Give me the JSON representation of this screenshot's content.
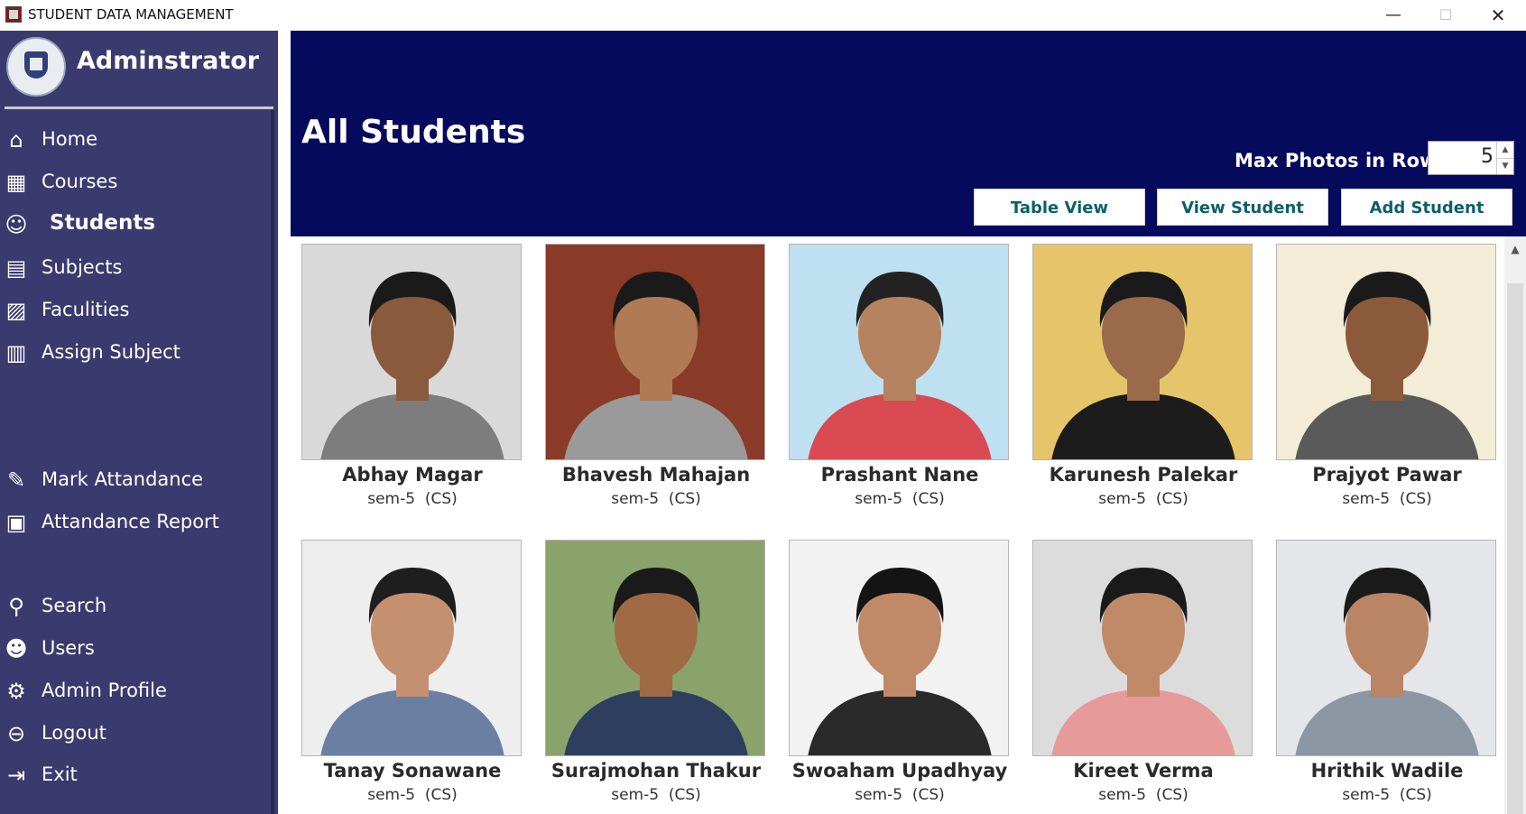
{
  "window": {
    "title": "STUDENT DATA MANAGEMENT",
    "min_glyph": "—",
    "max_glyph": "☐",
    "close_glyph": "✕"
  },
  "sidebar": {
    "title": "Adminstrator",
    "items": [
      {
        "label": "Home",
        "icon": "home-icon",
        "glyph": "⌂",
        "active": false
      },
      {
        "label": "Courses",
        "icon": "courses-icon",
        "glyph": "▦",
        "active": false
      },
      {
        "label": "Students",
        "icon": "student-icon",
        "glyph": "☺",
        "active": true
      },
      {
        "label": "Subjects",
        "icon": "subjects-icon",
        "glyph": "▤",
        "active": false
      },
      {
        "label": "Faculities",
        "icon": "faculties-icon",
        "glyph": "▨",
        "active": false
      },
      {
        "label": "Assign Subject",
        "icon": "assign-icon",
        "glyph": "▥",
        "active": false
      },
      {
        "label": "Mark Attandance",
        "icon": "attendance-icon",
        "glyph": "✎",
        "active": false
      },
      {
        "label": "Attandance Report",
        "icon": "report-icon",
        "glyph": "▣",
        "active": false
      },
      {
        "label": "Search",
        "icon": "search-icon",
        "glyph": "⚲",
        "active": false
      },
      {
        "label": "Users",
        "icon": "users-icon",
        "glyph": "☻",
        "active": false
      },
      {
        "label": "Admin Profile",
        "icon": "admin-profile-icon",
        "glyph": "⚙",
        "active": false
      },
      {
        "label": "Logout",
        "icon": "logout-icon",
        "glyph": "⊖",
        "active": false
      },
      {
        "label": "Exit",
        "icon": "exit-icon",
        "glyph": "⇥",
        "active": false
      }
    ]
  },
  "header": {
    "title": "All Students",
    "max_photos_label": "Max Photos in Row",
    "max_photos_value": "5",
    "table_view_label": "Table View",
    "view_student_label": "View Student",
    "add_student_label": "Add Student"
  },
  "students": [
    {
      "name": "Abhay Magar",
      "meta": "sem-5  (CS)",
      "bg": "#d9d9d9",
      "shirt": "#7d7d7d",
      "skin": "#8a5a3c",
      "hair": "#1a1a1a"
    },
    {
      "name": "Bhavesh Mahajan",
      "meta": "sem-5  (CS)",
      "bg": "#8a3b28",
      "shirt": "#9a9a9a",
      "skin": "#b07a55",
      "hair": "#1a1a1a"
    },
    {
      "name": "Prashant Nane",
      "meta": "sem-5  (CS)",
      "bg": "#bfe0f0",
      "shirt": "#d94a52",
      "skin": "#b58360",
      "hair": "#222222"
    },
    {
      "name": "Karunesh Palekar",
      "meta": "sem-5  (CS)",
      "bg": "#e6c56a",
      "shirt": "#1c1c1c",
      "skin": "#9a6a4a",
      "hair": "#1a1a1a"
    },
    {
      "name": "Prajyot Pawar",
      "meta": "sem-5  (CS)",
      "bg": "#f3ecd6",
      "shirt": "#5a5a5a",
      "skin": "#8b5a3a",
      "hair": "#1a1a1a"
    },
    {
      "name": "Tanay Sonawane",
      "meta": "sem-5  (CS)",
      "bg": "#eeeeee",
      "shirt": "#6b7fa3",
      "skin": "#c49070",
      "hair": "#1e1e1e"
    },
    {
      "name": "Surajmohan  Thakur",
      "meta": "sem-5  (CS)",
      "bg": "#8aa36a",
      "shirt": "#2e3e5e",
      "skin": "#a06a45",
      "hair": "#1a1a1a"
    },
    {
      "name": "Swoaham Upadhyay",
      "meta": "sem-5  (CS)",
      "bg": "#f2f2f2",
      "shirt": "#2a2a2a",
      "skin": "#c08a68",
      "hair": "#141414"
    },
    {
      "name": "Kireet Verma",
      "meta": "sem-5  (CS)",
      "bg": "#dcdcdc",
      "shirt": "#e79a9a",
      "skin": "#c08a68",
      "hair": "#1a1a1a"
    },
    {
      "name": "Hrithik Wadile",
      "meta": "sem-5  (CS)",
      "bg": "#e4e6ea",
      "shirt": "#8d96a3",
      "skin": "#b98565",
      "hair": "#1a1a1a"
    }
  ],
  "colors": {
    "sidebar_bg": "#3b3a6e",
    "header_bg": "#050a5c",
    "button_text": "#0b5f6b"
  }
}
